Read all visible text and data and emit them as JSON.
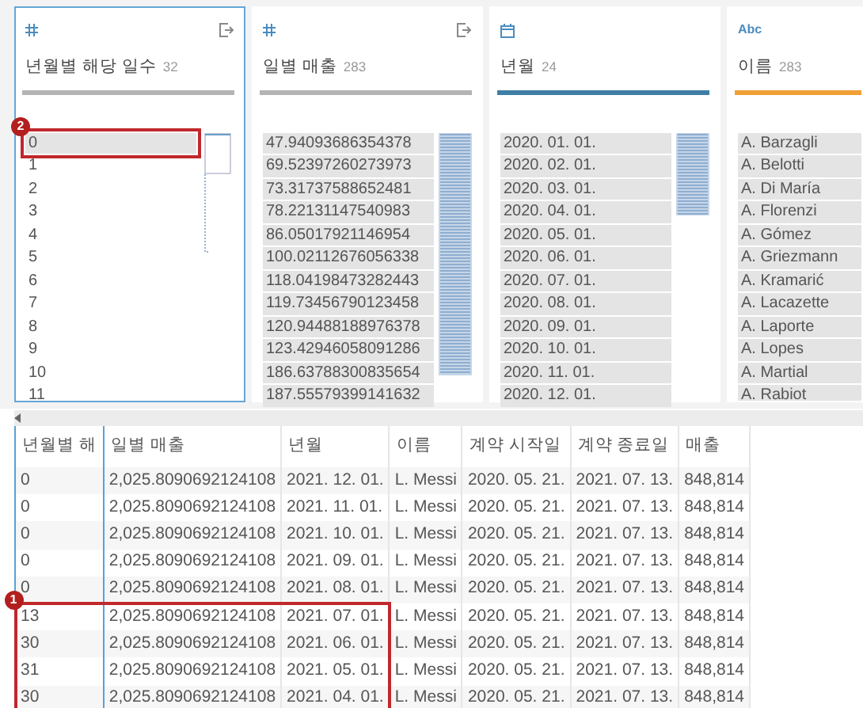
{
  "cards": [
    {
      "kind": "number",
      "title": "년월별 해당 일수",
      "count": "32",
      "color": "#b4b4b4",
      "selected": true,
      "export_icon": true,
      "scrollbar": {
        "kind": "thumb"
      },
      "values": [
        {
          "text": "0",
          "selected": true
        },
        {
          "text": "1",
          "selected": false
        },
        {
          "text": "2",
          "selected": false
        },
        {
          "text": "3",
          "selected": false
        },
        {
          "text": "4",
          "selected": false
        },
        {
          "text": "5",
          "selected": false
        },
        {
          "text": "6",
          "selected": false
        },
        {
          "text": "7",
          "selected": false
        },
        {
          "text": "8",
          "selected": false
        },
        {
          "text": "9",
          "selected": false
        },
        {
          "text": "10",
          "selected": false
        },
        {
          "text": "11",
          "selected": false
        }
      ]
    },
    {
      "kind": "number",
      "title": "일별 매출",
      "count": "283",
      "color": "#b4b4b4",
      "selected": false,
      "export_icon": true,
      "scrollbar": {
        "kind": "tall"
      },
      "values": [
        {
          "text": "47.94093686354378",
          "selected": false
        },
        {
          "text": "69.52397260273973",
          "selected": false
        },
        {
          "text": "73.31737588652481",
          "selected": false
        },
        {
          "text": "78.22131147540983",
          "selected": false
        },
        {
          "text": "86.05017921146954",
          "selected": false
        },
        {
          "text": "100.02112676056338",
          "selected": false
        },
        {
          "text": "118.04198473282443",
          "selected": false
        },
        {
          "text": "119.73456790123458",
          "selected": false
        },
        {
          "text": "120.94488188976378",
          "selected": false
        },
        {
          "text": "123.42946058091286",
          "selected": false
        },
        {
          "text": "186.63788300835654",
          "selected": false
        },
        {
          "text": "187.55579399141632",
          "selected": false
        }
      ]
    },
    {
      "kind": "date",
      "title": "년월",
      "count": "24",
      "color": "#3f7fa6",
      "selected": false,
      "export_icon": false,
      "scrollbar": {
        "kind": "short"
      },
      "values": [
        {
          "text": "2020. 01. 01.",
          "selected": false
        },
        {
          "text": "2020. 02. 01.",
          "selected": false
        },
        {
          "text": "2020. 03. 01.",
          "selected": false
        },
        {
          "text": "2020. 04. 01.",
          "selected": false
        },
        {
          "text": "2020. 05. 01.",
          "selected": false
        },
        {
          "text": "2020. 06. 01.",
          "selected": false
        },
        {
          "text": "2020. 07. 01.",
          "selected": false
        },
        {
          "text": "2020. 08. 01.",
          "selected": false
        },
        {
          "text": "2020. 09. 01.",
          "selected": false
        },
        {
          "text": "2020. 10. 01.",
          "selected": false
        },
        {
          "text": "2020. 11. 01.",
          "selected": false
        },
        {
          "text": "2020. 12. 01.",
          "selected": false
        }
      ]
    },
    {
      "kind": "text",
      "type_label": "Abc",
      "title": "이름",
      "count": "283",
      "color": "#f0a035",
      "selected": false,
      "export_icon": false,
      "values": [
        {
          "text": "A. Barzagli",
          "selected": false
        },
        {
          "text": "A. Belotti",
          "selected": false
        },
        {
          "text": "A. Di María",
          "selected": false
        },
        {
          "text": "A. Florenzi",
          "selected": false
        },
        {
          "text": "A. Gómez",
          "selected": false
        },
        {
          "text": "A. Griezmann",
          "selected": false
        },
        {
          "text": "A. Kramarić",
          "selected": false
        },
        {
          "text": "A. Lacazette",
          "selected": false
        },
        {
          "text": "A. Laporte",
          "selected": false
        },
        {
          "text": "A. Lopes",
          "selected": false
        },
        {
          "text": "A. Martial",
          "selected": false
        },
        {
          "text": "A. Rabiot",
          "selected": false
        }
      ]
    }
  ],
  "table": {
    "columns": [
      {
        "label": "년월별 해",
        "selected": true
      },
      {
        "label": "일별 매출",
        "selected": false
      },
      {
        "label": "년월",
        "selected": false
      },
      {
        "label": "이름",
        "selected": false
      },
      {
        "label": "계약 시작일",
        "selected": false
      },
      {
        "label": "계약 종료일",
        "selected": false
      },
      {
        "label": "매출",
        "selected": false
      }
    ],
    "rows": [
      [
        "0",
        "2,025.8090692124108",
        "2021. 12. 01.",
        "L. Messi",
        "2020. 05. 21.",
        "2021. 07. 13.",
        "848,814"
      ],
      [
        "0",
        "2,025.8090692124108",
        "2021. 11. 01.",
        "L. Messi",
        "2020. 05. 21.",
        "2021. 07. 13.",
        "848,814"
      ],
      [
        "0",
        "2,025.8090692124108",
        "2021. 10. 01.",
        "L. Messi",
        "2020. 05. 21.",
        "2021. 07. 13.",
        "848,814"
      ],
      [
        "0",
        "2,025.8090692124108",
        "2021. 09. 01.",
        "L. Messi",
        "2020. 05. 21.",
        "2021. 07. 13.",
        "848,814"
      ],
      [
        "0",
        "2,025.8090692124108",
        "2021. 08. 01.",
        "L. Messi",
        "2020. 05. 21.",
        "2021. 07. 13.",
        "848,814"
      ],
      [
        "13",
        "2,025.8090692124108",
        "2021. 07. 01.",
        "L. Messi",
        "2020. 05. 21.",
        "2021. 07. 13.",
        "848,814"
      ],
      [
        "30",
        "2,025.8090692124108",
        "2021. 06. 01.",
        "L. Messi",
        "2020. 05. 21.",
        "2021. 07. 13.",
        "848,814"
      ],
      [
        "31",
        "2,025.8090692124108",
        "2021. 05. 01.",
        "L. Messi",
        "2020. 05. 21.",
        "2021. 07. 13.",
        "848,814"
      ],
      [
        "30",
        "2,025.8090692124108",
        "2021. 04. 01.",
        "L. Messi",
        "2020. 05. 21.",
        "2021. 07. 13.",
        "848,814"
      ]
    ]
  },
  "annotations": [
    {
      "label": "2"
    },
    {
      "label": "1"
    }
  ]
}
